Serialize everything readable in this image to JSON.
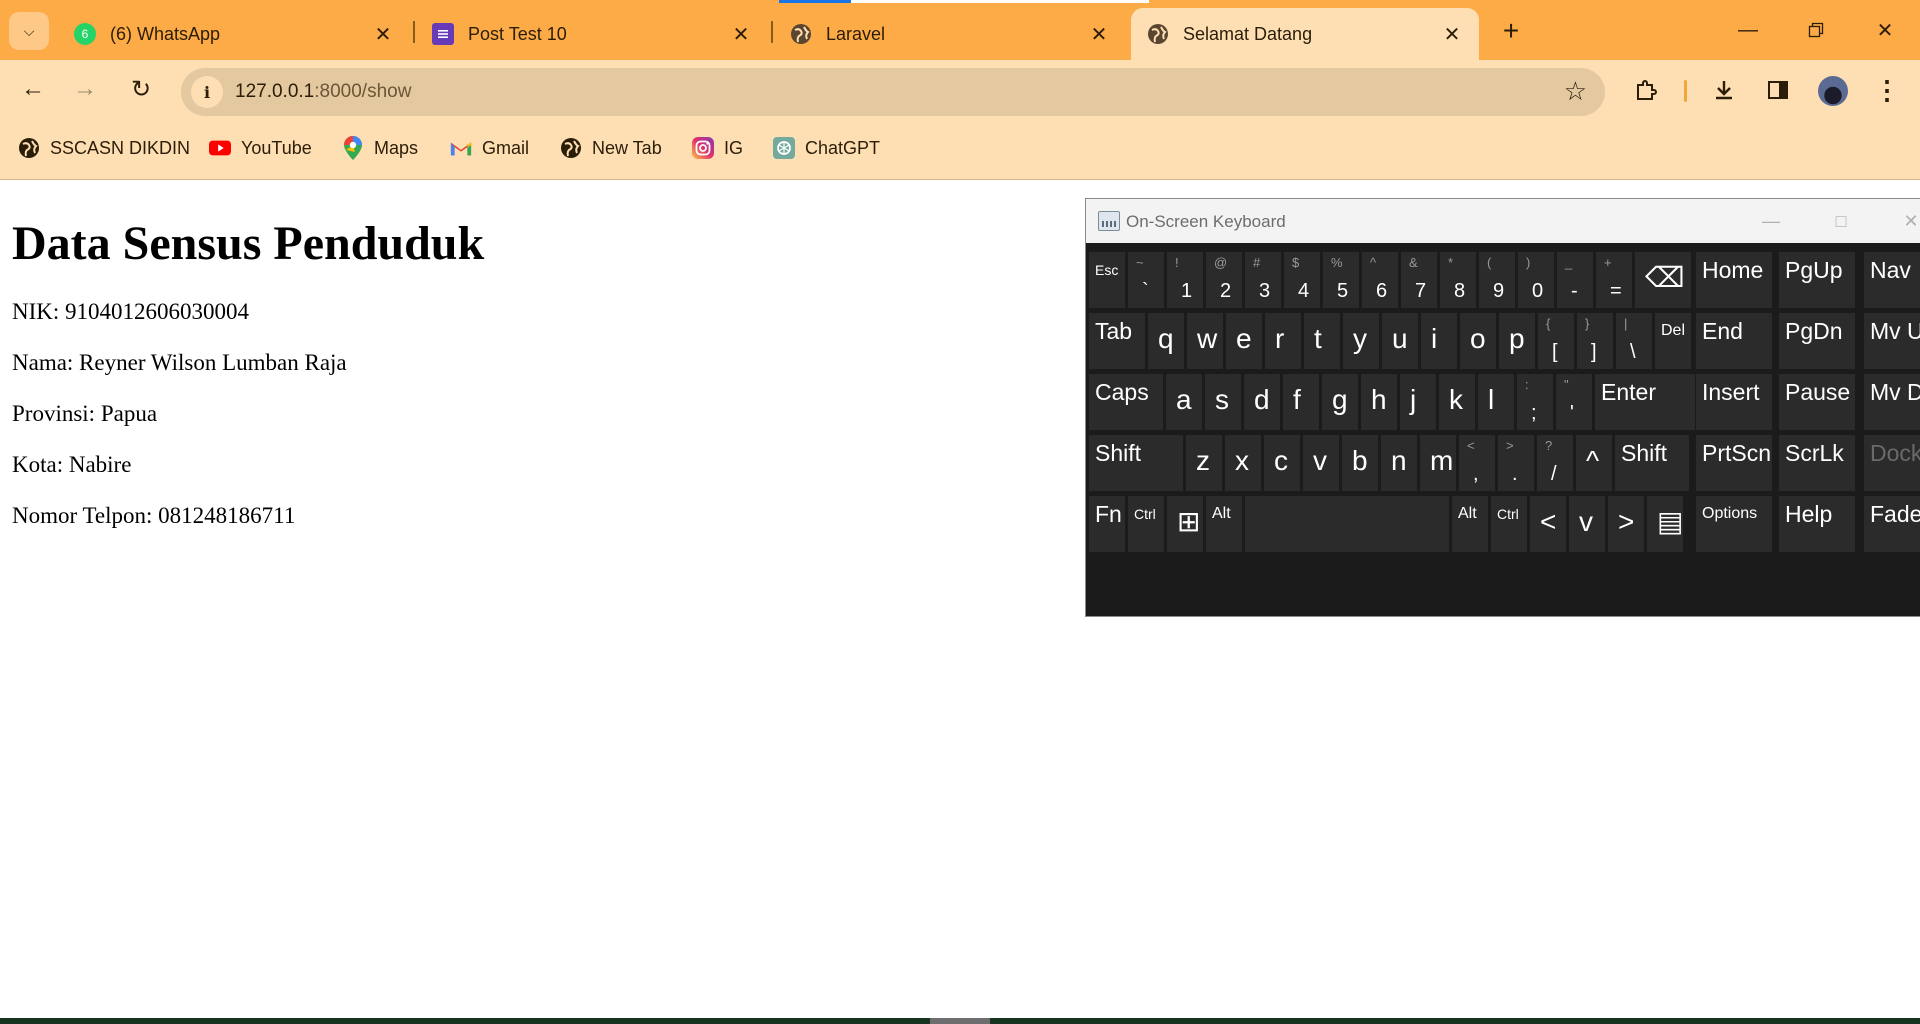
{
  "browser": {
    "tabs": [
      {
        "title": "(6) WhatsApp",
        "icon": "whatsapp-icon",
        "badge": "6",
        "active": false
      },
      {
        "title": "Post Test 10",
        "icon": "forms-icon",
        "active": false
      },
      {
        "title": "Laravel",
        "icon": "globe-icon",
        "active": false,
        "loading": true
      },
      {
        "title": "Selamat Datang",
        "icon": "globe-icon",
        "active": true
      }
    ],
    "url": {
      "host": "127.0.0.1",
      "path": ":8000/show"
    },
    "bookmarks": [
      {
        "label": "SSCASN DIKDIN",
        "icon": "globe-icon"
      },
      {
        "label": "YouTube",
        "icon": "youtube-icon"
      },
      {
        "label": "Maps",
        "icon": "maps-icon"
      },
      {
        "label": "Gmail",
        "icon": "gmail-icon"
      },
      {
        "label": "New Tab",
        "icon": "globe-icon"
      },
      {
        "label": "IG",
        "icon": "instagram-icon"
      },
      {
        "label": "ChatGPT",
        "icon": "chatgpt-icon"
      }
    ],
    "colors": {
      "frame": "#fdab46",
      "toolbar": "#fedfb4",
      "omnibox": "#e4c8a0"
    }
  },
  "page": {
    "heading": "Data Sensus Penduduk",
    "fields": [
      "NIK: 9104012606030004",
      "Nama: Reyner Wilson Lumban Raja",
      "Provinsi: Papua",
      "Kota: Nabire",
      "Nomor Telpon: 081248186711"
    ]
  },
  "osk": {
    "title": "On-Screen Keyboard",
    "row1": [
      {
        "main": "Esc"
      },
      {
        "shift": "~",
        "main": "`"
      },
      {
        "shift": "!",
        "main": "1"
      },
      {
        "shift": "@",
        "main": "2"
      },
      {
        "shift": "#",
        "main": "3"
      },
      {
        "shift": "$",
        "main": "4"
      },
      {
        "shift": "%",
        "main": "5"
      },
      {
        "shift": "^",
        "main": "6"
      },
      {
        "shift": "&",
        "main": "7"
      },
      {
        "shift": "*",
        "main": "8"
      },
      {
        "shift": "(",
        "main": "9"
      },
      {
        "shift": ")",
        "main": "0"
      },
      {
        "shift": "_",
        "main": "-"
      },
      {
        "shift": "+",
        "main": "="
      },
      {
        "main": "⌫"
      }
    ],
    "row2": [
      {
        "main": "Tab"
      },
      {
        "main": "q"
      },
      {
        "main": "w"
      },
      {
        "main": "e"
      },
      {
        "main": "r"
      },
      {
        "main": "t"
      },
      {
        "main": "y"
      },
      {
        "main": "u"
      },
      {
        "main": "i"
      },
      {
        "main": "o"
      },
      {
        "main": "p"
      },
      {
        "shift": "{",
        "main": "["
      },
      {
        "shift": "}",
        "main": "]"
      },
      {
        "shift": "|",
        "main": "\\"
      },
      {
        "main": "Del"
      }
    ],
    "row3": [
      {
        "main": "Caps"
      },
      {
        "main": "a"
      },
      {
        "main": "s"
      },
      {
        "main": "d"
      },
      {
        "main": "f"
      },
      {
        "main": "g"
      },
      {
        "main": "h"
      },
      {
        "main": "j"
      },
      {
        "main": "k"
      },
      {
        "main": "l"
      },
      {
        "shift": ":",
        "main": ";"
      },
      {
        "shift": "\"",
        "main": "'"
      },
      {
        "main": "Enter"
      }
    ],
    "row4": [
      {
        "main": "Shift"
      },
      {
        "main": "z"
      },
      {
        "main": "x"
      },
      {
        "main": "c"
      },
      {
        "main": "v"
      },
      {
        "main": "b"
      },
      {
        "main": "n"
      },
      {
        "main": "m"
      },
      {
        "shift": "<",
        "main": ","
      },
      {
        "shift": ">",
        "main": "."
      },
      {
        "shift": "?",
        "main": "/"
      },
      {
        "main": "^"
      },
      {
        "main": "Shift"
      }
    ],
    "row5": [
      {
        "main": "Fn"
      },
      {
        "main": "Ctrl"
      },
      {
        "main": "⊞"
      },
      {
        "main": "Alt"
      },
      {
        "main": ""
      },
      {
        "main": "Alt"
      },
      {
        "main": "Ctrl"
      },
      {
        "main": "<"
      },
      {
        "main": "v"
      },
      {
        "main": ">"
      },
      {
        "main": "▤"
      }
    ],
    "nav": [
      [
        "Home",
        "PgUp",
        "Nav"
      ],
      [
        "End",
        "PgDn",
        "Mv Up"
      ],
      [
        "Insert",
        "Pause",
        "Mv Dn"
      ],
      [
        "PrtScn",
        "ScrLk",
        "Dock"
      ],
      [
        "Options",
        "Help",
        "Fade"
      ]
    ]
  }
}
